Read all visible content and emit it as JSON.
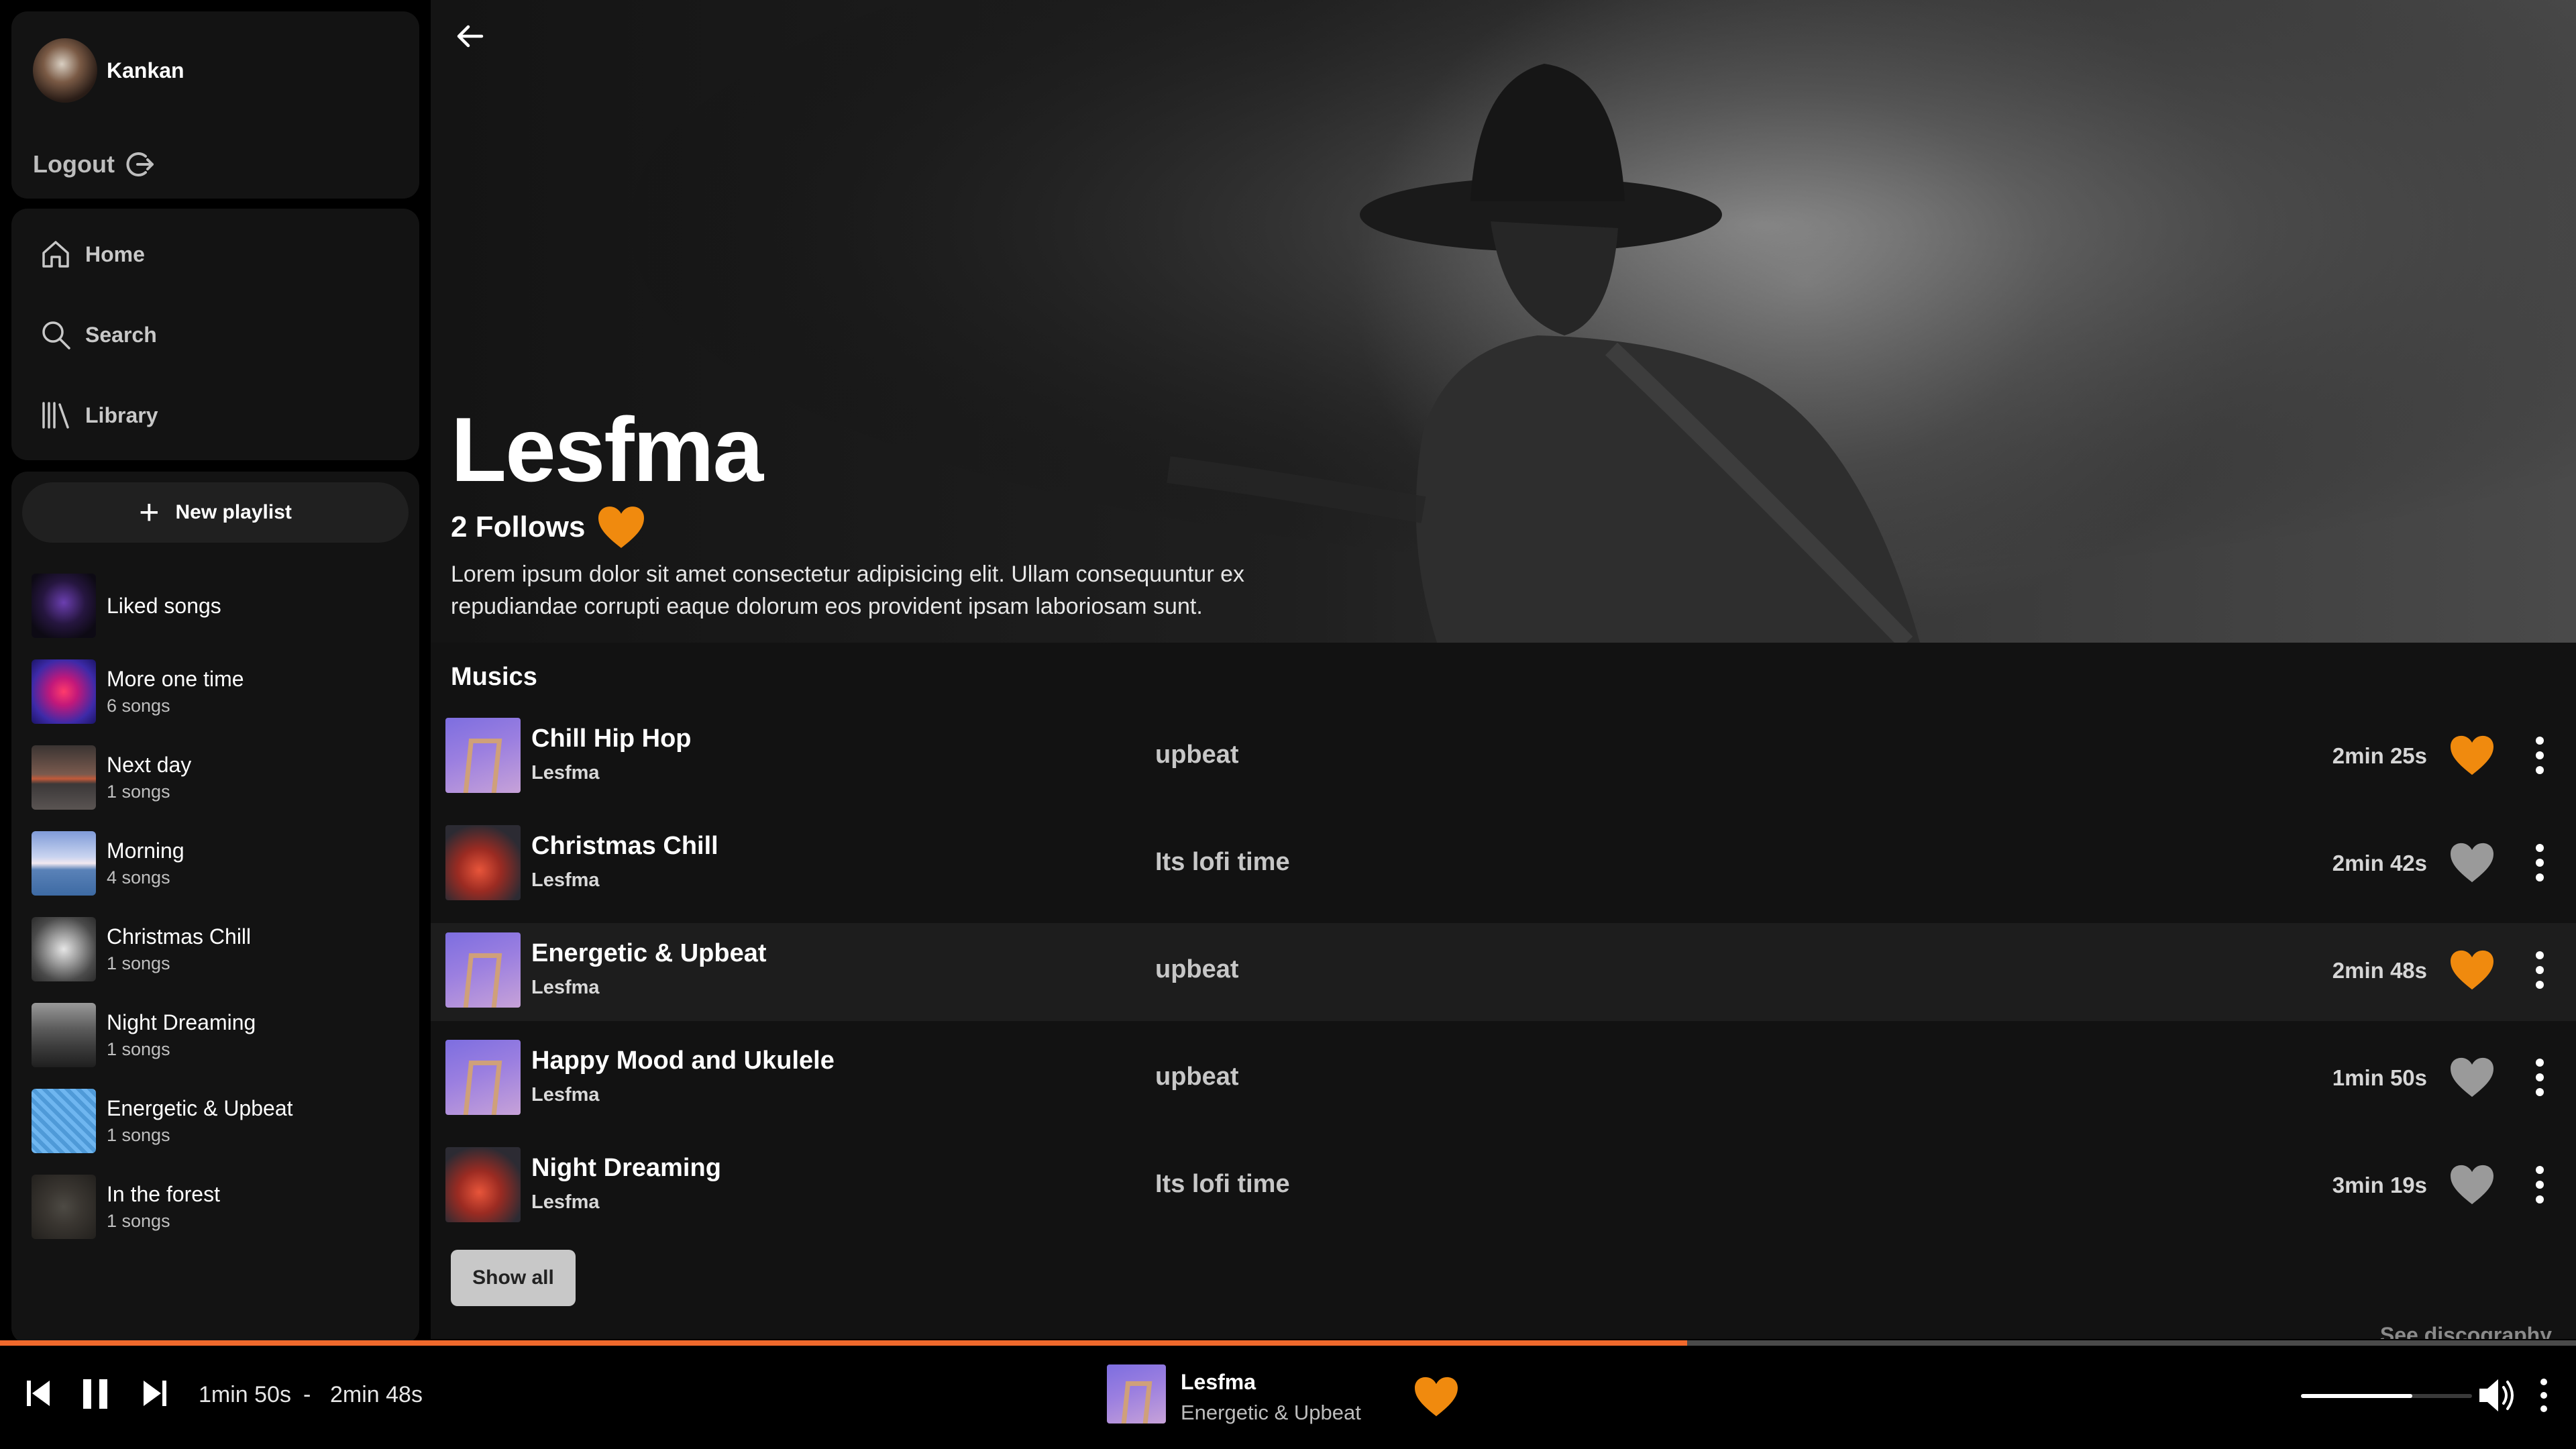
{
  "user": {
    "name": "Kankan",
    "logout_label": "Logout"
  },
  "nav": [
    {
      "label": "Home",
      "icon": "home-icon"
    },
    {
      "label": "Search",
      "icon": "search-icon"
    },
    {
      "label": "Library",
      "icon": "library-icon"
    }
  ],
  "library": {
    "new_playlist_label": "New playlist",
    "playlists": [
      {
        "name": "Liked songs",
        "count": ""
      },
      {
        "name": "More one time",
        "count": "6 songs"
      },
      {
        "name": "Next day",
        "count": "1 songs"
      },
      {
        "name": "Morning",
        "count": "4 songs"
      },
      {
        "name": "Christmas Chill",
        "count": "1 songs"
      },
      {
        "name": "Night Dreaming",
        "count": "1 songs"
      },
      {
        "name": "Energetic & Upbeat",
        "count": "1 songs"
      },
      {
        "name": "In the forest",
        "count": "1 songs"
      }
    ]
  },
  "artist": {
    "name": "Lesfma",
    "follows": "2 Follows",
    "bio": "Lorem ipsum dolor sit amet consectetur adipisicing elit. Ullam consequuntur ex repudiandae corrupti eaque dolorum eos provident ipsam laboriosam sunt."
  },
  "musics": {
    "section_title": "Musics",
    "tracks": [
      {
        "title": "Chill Hip Hop",
        "artist": "Lesfma",
        "tag": "upbeat",
        "duration": "2min 25s",
        "liked": true
      },
      {
        "title": "Christmas Chill",
        "artist": "Lesfma",
        "tag": "Its lofi time",
        "duration": "2min 42s",
        "liked": false
      },
      {
        "title": "Energetic & Upbeat",
        "artist": "Lesfma",
        "tag": "upbeat",
        "duration": "2min 48s",
        "liked": true
      },
      {
        "title": "Happy Mood and Ukulele",
        "artist": "Lesfma",
        "tag": "upbeat",
        "duration": "1min 50s",
        "liked": false
      },
      {
        "title": "Night Dreaming",
        "artist": "Lesfma",
        "tag": "Its lofi time",
        "duration": "3min 19s",
        "liked": false
      }
    ],
    "show_all_label": "Show all",
    "see_discography_label": "See discography"
  },
  "player": {
    "current_time": "1min 50s",
    "separator": "-",
    "total_time": "2min 48s",
    "progress": 0.655,
    "now_playing_artist": "Lesfma",
    "now_playing_title": "Energetic & Upbeat",
    "liked": true,
    "volume": 0.65
  },
  "colors": {
    "accent": "#f0692c",
    "heart_liked": "#f08a0e",
    "heart_unliked": "#9a9a9a"
  }
}
